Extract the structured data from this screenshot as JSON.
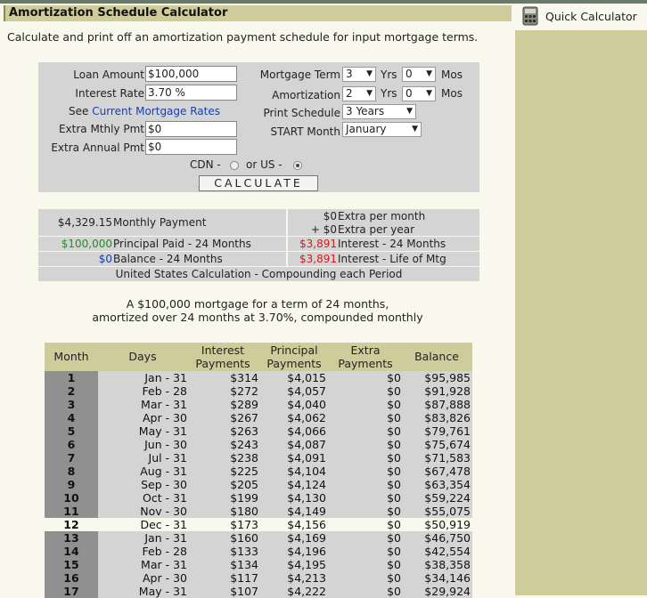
{
  "title": "Amortization Schedule Calculator",
  "description": "Calculate and print off an amortization payment schedule for input mortgage terms.",
  "sidebar": {
    "quick_calculator": "Quick Calculator"
  },
  "form": {
    "loan_amount_label": "Loan Amount",
    "loan_amount_value": "$100,000",
    "interest_rate_label": "Interest Rate",
    "interest_rate_value": "3.70 %",
    "see_label": "See",
    "mortgage_rates_link": "Current Mortgage Rates",
    "extra_monthly_label": "Extra Mthly Pmt",
    "extra_monthly_value": "$0",
    "extra_annual_label": "Extra Annual Pmt",
    "extra_annual_value": "$0",
    "mortgage_term_label": "Mortgage Term",
    "mortgage_term_years": "3",
    "mortgage_term_months": "0",
    "amortization_label": "Amortization",
    "amortization_years": "2",
    "amortization_months": "0",
    "yrs": "Yrs",
    "mos": "Mos",
    "print_schedule_label": "Print Schedule",
    "print_schedule_value": "3 Years",
    "start_month_label": "START Month",
    "start_month_value": "January",
    "cdn_label": "CDN -",
    "us_label": "or US -",
    "selected_region": "US",
    "calculate_label": "CALCULATE"
  },
  "summary": {
    "monthly_payment_value": "$4,329.15",
    "monthly_payment_label": "Monthly Payment",
    "extra_month_value": "$0",
    "extra_month_label": "Extra per month",
    "extra_year_value": "+ $0",
    "extra_year_label": "Extra per year",
    "principal_paid_value": "$100,000",
    "principal_paid_label": "Principal Paid - 24 Months",
    "interest_24_value": "$3,891",
    "interest_24_label": "Interest - 24 Months",
    "balance_value": "$0",
    "balance_label": "Balance - 24 Months",
    "interest_life_value": "$3,891",
    "interest_life_label": "Interest - Life of Mtg",
    "calc_note": "United States Calculation - Compounding each Period"
  },
  "mortgage_text_line1": "A $100,000 mortgage for a term of 24 months,",
  "mortgage_text_line2": "amortized over 24 months at 3.70%, compounded monthly",
  "schedule": {
    "headers": {
      "month": "Month",
      "days": "Days",
      "interest_1": "Interest",
      "interest_2": "Payments",
      "principal_1": "Principal",
      "principal_2": "Payments",
      "extra_1": "Extra",
      "extra_2": "Payments",
      "balance": "Balance"
    },
    "rows": [
      {
        "month": "1",
        "days": "Jan - 31",
        "interest": "$314",
        "principal": "$4,015",
        "extra": "$0",
        "balance": "$95,985"
      },
      {
        "month": "2",
        "days": "Feb - 28",
        "interest": "$272",
        "principal": "$4,057",
        "extra": "$0",
        "balance": "$91,928"
      },
      {
        "month": "3",
        "days": "Mar - 31",
        "interest": "$289",
        "principal": "$4,040",
        "extra": "$0",
        "balance": "$87,888"
      },
      {
        "month": "4",
        "days": "Apr - 30",
        "interest": "$267",
        "principal": "$4,062",
        "extra": "$0",
        "balance": "$83,826"
      },
      {
        "month": "5",
        "days": "May - 31",
        "interest": "$263",
        "principal": "$4,066",
        "extra": "$0",
        "balance": "$79,761"
      },
      {
        "month": "6",
        "days": "Jun - 30",
        "interest": "$243",
        "principal": "$4,087",
        "extra": "$0",
        "balance": "$75,674"
      },
      {
        "month": "7",
        "days": "Jul - 31",
        "interest": "$238",
        "principal": "$4,091",
        "extra": "$0",
        "balance": "$71,583"
      },
      {
        "month": "8",
        "days": "Aug - 31",
        "interest": "$225",
        "principal": "$4,104",
        "extra": "$0",
        "balance": "$67,478"
      },
      {
        "month": "9",
        "days": "Sep - 30",
        "interest": "$205",
        "principal": "$4,124",
        "extra": "$0",
        "balance": "$63,354"
      },
      {
        "month": "10",
        "days": "Oct - 31",
        "interest": "$199",
        "principal": "$4,130",
        "extra": "$0",
        "balance": "$59,224"
      },
      {
        "month": "11",
        "days": "Nov - 30",
        "interest": "$180",
        "principal": "$4,149",
        "extra": "$0",
        "balance": "$55,075"
      },
      {
        "month": "12",
        "days": "Dec - 31",
        "interest": "$173",
        "principal": "$4,156",
        "extra": "$0",
        "balance": "$50,919",
        "highlight": true
      },
      {
        "month": "13",
        "days": "Jan - 31",
        "interest": "$160",
        "principal": "$4,169",
        "extra": "$0",
        "balance": "$46,750"
      },
      {
        "month": "14",
        "days": "Feb - 28",
        "interest": "$133",
        "principal": "$4,196",
        "extra": "$0",
        "balance": "$42,554"
      },
      {
        "month": "15",
        "days": "Mar - 31",
        "interest": "$134",
        "principal": "$4,195",
        "extra": "$0",
        "balance": "$38,358"
      },
      {
        "month": "16",
        "days": "Apr - 30",
        "interest": "$117",
        "principal": "$4,213",
        "extra": "$0",
        "balance": "$34,146"
      },
      {
        "month": "17",
        "days": "May - 31",
        "interest": "$107",
        "principal": "$4,222",
        "extra": "$0",
        "balance": "$29,924"
      }
    ]
  }
}
